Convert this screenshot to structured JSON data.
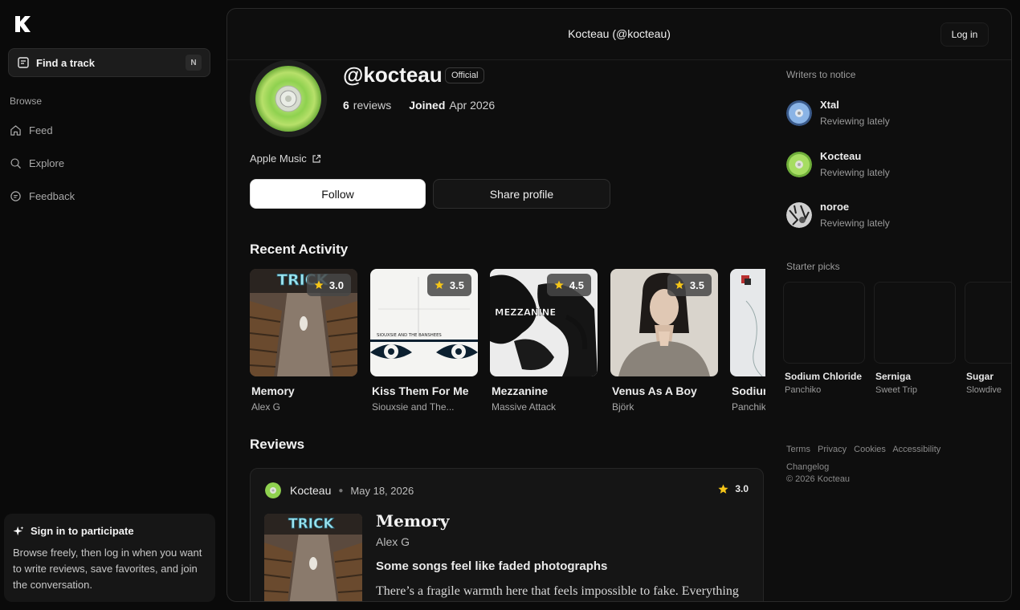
{
  "sidebar": {
    "find_track": "Find a track",
    "find_track_shortcut": "N",
    "browse_label": "Browse",
    "nav": [
      {
        "label": "Feed",
        "icon": "home-icon"
      },
      {
        "label": "Explore",
        "icon": "search-icon"
      },
      {
        "label": "Feedback",
        "icon": "chat-icon"
      }
    ],
    "signin": {
      "title": "Sign in to participate",
      "text": "Browse freely, then log in when you want to write reviews, save favorites, and join the conversation."
    }
  },
  "header": {
    "title": "Kocteau (@kocteau)",
    "login": "Log in"
  },
  "profile": {
    "handle": "@kocteau",
    "badge": "Official",
    "reviews_count": "6",
    "reviews_label": "reviews",
    "joined_label": "Joined",
    "joined_date": "Apr 2026",
    "link_label": "Apple Music",
    "follow": "Follow",
    "share": "Share profile"
  },
  "recent_activity": {
    "title": "Recent Activity",
    "items": [
      {
        "title": "Memory",
        "artist": "Alex G",
        "rating": "3.0"
      },
      {
        "title": "Kiss Them For Me",
        "artist": "Siouxsie and The...",
        "rating": "3.5"
      },
      {
        "title": "Mezzanine",
        "artist": "Massive Attack",
        "rating": "4.5"
      },
      {
        "title": "Venus As A Boy",
        "artist": "Björk",
        "rating": "3.5"
      },
      {
        "title": "Sodium Chloride",
        "artist": "Panchiko",
        "rating": ""
      }
    ]
  },
  "reviews": {
    "title": "Reviews",
    "items": [
      {
        "author": "Kocteau",
        "date": "May 18, 2026",
        "rating": "3.0",
        "track": "Memory",
        "artist": "Alex G",
        "heading": "Some songs feel like faded photographs",
        "body": "There’s a fragile warmth here that feels impossible to fake. Everything"
      }
    ]
  },
  "cover_text": {
    "memory": "TRICK",
    "kiss_band": "SIOUXSIE AND THE BANSHEES",
    "mezzanine": "MEZZANINE"
  },
  "right": {
    "writers_label": "Writers to notice",
    "writers": [
      {
        "name": "Xtal",
        "sub": "Reviewing lately"
      },
      {
        "name": "Kocteau",
        "sub": "Reviewing lately"
      },
      {
        "name": "noroe",
        "sub": "Reviewing lately"
      }
    ],
    "starter_label": "Starter picks",
    "starters": [
      {
        "title": "Sodium Chloride",
        "artist": "Panchiko"
      },
      {
        "title": "Serniga",
        "artist": "Sweet Trip"
      },
      {
        "title": "Sugar",
        "artist": "Slowdive"
      }
    ],
    "footer": [
      "Terms",
      "Privacy",
      "Cookies",
      "Accessibility",
      "Changelog"
    ],
    "copyright": "© 2026 Kocteau"
  },
  "colors": {
    "background": "#0a0a0a",
    "star": "#f5c518",
    "accent_disc": "#8fd14f"
  }
}
